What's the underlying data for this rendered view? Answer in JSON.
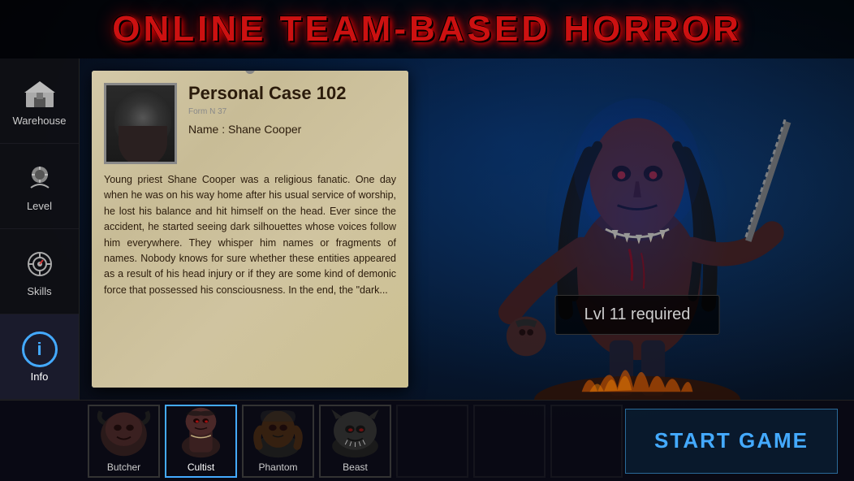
{
  "title": {
    "text": "ONLINE TEAM-BASED HORROR"
  },
  "sidebar": {
    "items": [
      {
        "id": "warehouse",
        "label": "Warehouse",
        "active": false
      },
      {
        "id": "level",
        "label": "Level",
        "active": false
      },
      {
        "id": "skills",
        "label": "Skills",
        "active": false
      },
      {
        "id": "info",
        "label": "Info",
        "active": true
      }
    ]
  },
  "case": {
    "title": "Personal Case 102",
    "form_no": "Form N 37",
    "name_label": "Name : Shane Cooper",
    "body": "Young priest Shane Cooper was a religious fanatic. One day when he was on his way home after his usual service of worship, he lost his balance and hit himself on the head. Ever since the accident, he started seeing dark silhouettes whose voices follow him everywhere. They whisper him names or fragments of names. Nobody knows for sure whether these entities appeared as a result of his head injury or if they are some kind of demonic force that possessed his consciousness. In the end, the \"dark..."
  },
  "monster": {
    "lvl_required": "Lvl 11 required"
  },
  "characters": [
    {
      "id": "butcher",
      "label": "Butcher",
      "active": false
    },
    {
      "id": "cultist",
      "label": "Cultist",
      "active": true
    },
    {
      "id": "phantom",
      "label": "Phantom",
      "active": false
    },
    {
      "id": "beast",
      "label": "Beast",
      "active": false
    }
  ],
  "start_button": {
    "label": "START GAME"
  }
}
